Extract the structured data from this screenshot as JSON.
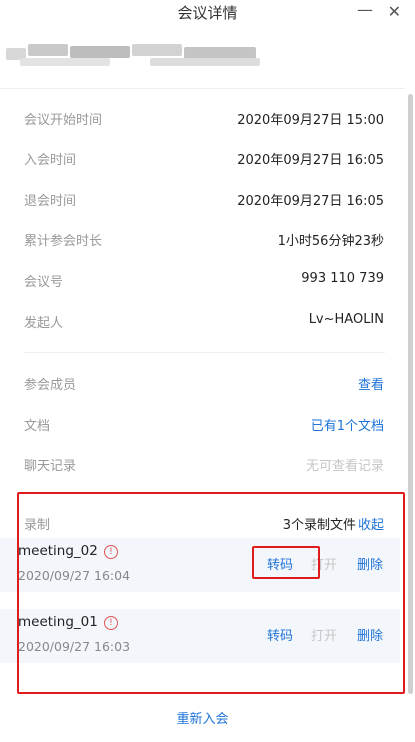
{
  "window": {
    "title": "会议详情",
    "minimize_glyph": "—",
    "close_glyph": "✕"
  },
  "info_rows": [
    {
      "label": "会议开始时间",
      "value": "2020年09月27日 15:00"
    },
    {
      "label": "入会时间",
      "value": "2020年09月27日 16:05"
    },
    {
      "label": "退会时间",
      "value": "2020年09月27日 16:05"
    },
    {
      "label": "累计参会时长",
      "value": "1小时56分钟23秒"
    },
    {
      "label": "会议号",
      "value": "993 110 739"
    },
    {
      "label": "发起人",
      "value": "Lv~HAOLIN"
    }
  ],
  "links": {
    "members": {
      "label": "参会成员",
      "action": "查看"
    },
    "docs": {
      "label": "文档",
      "action": "已有1个文档"
    },
    "chat": {
      "label": "聊天记录",
      "action": "无可查看记录"
    }
  },
  "recordings": {
    "label": "录制",
    "count_text": "3个录制文件",
    "collapse": "收起",
    "items": [
      {
        "name": "meeting_02",
        "time": "2020/09/27 16:04",
        "transcode": "转码",
        "open": "打开",
        "delete": "删除"
      },
      {
        "name": "meeting_01",
        "time": "2020/09/27 16:03",
        "transcode": "转码",
        "open": "打开",
        "delete": "删除"
      }
    ]
  },
  "footer": {
    "rejoin": "重新入会"
  },
  "colors": {
    "accent": "#1e73d8",
    "highlight_box": "#e01b1b",
    "row_bg": "#f3f6fb"
  }
}
